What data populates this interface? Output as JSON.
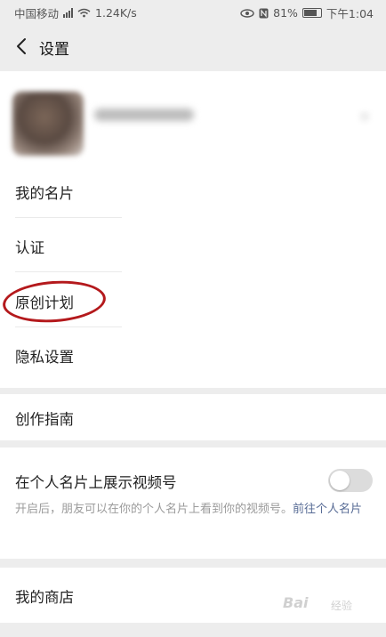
{
  "status_bar": {
    "carrier": "中国移动",
    "speed": "1.24K/s",
    "battery": "81%",
    "time": "下午1:04"
  },
  "nav": {
    "title": "设置"
  },
  "menu": {
    "group1": [
      "我的名片",
      "认证",
      "原创计划",
      "隐私设置"
    ],
    "group2": [
      "创作指南"
    ],
    "video": {
      "label": "在个人名片上展示视频号",
      "toggle_on": false,
      "desc_text": "开启后，朋友可以在你的个人名片上看到你的视频号。",
      "desc_link": "前往个人名片"
    },
    "group3": [
      "我的商店"
    ]
  },
  "watermark": {
    "text": "Bai",
    "sub": "经验"
  },
  "colors": {
    "background": "#ededed",
    "surface": "#ffffff",
    "link": "#576b95",
    "annotation": "#b4191c"
  }
}
